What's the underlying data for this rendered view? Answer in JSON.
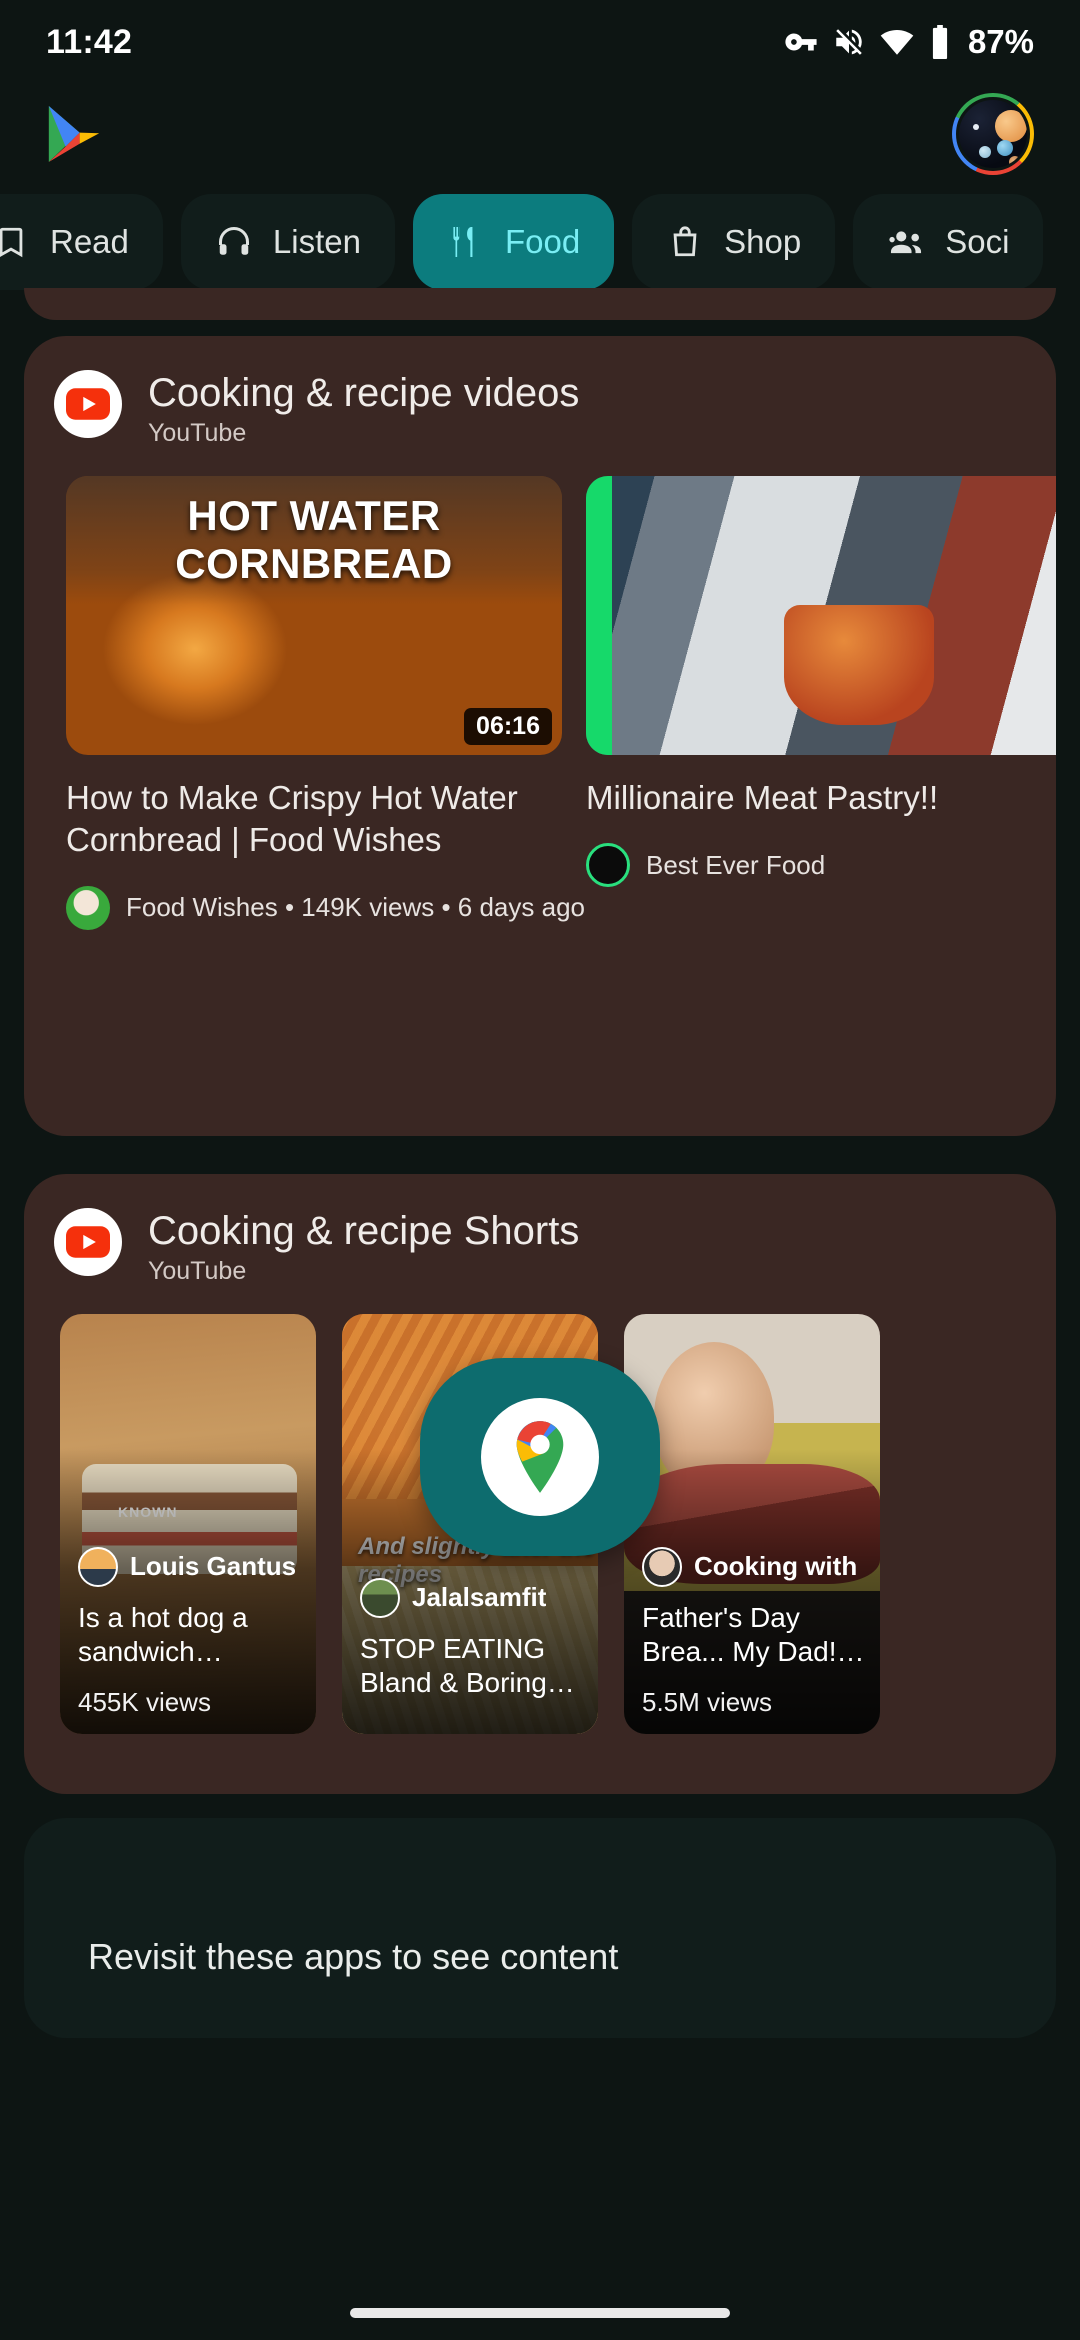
{
  "status_bar": {
    "time": "11:42",
    "battery_pct": "87%",
    "icons": [
      "vpn-key-icon",
      "volume-off-icon",
      "wifi-icon",
      "battery-icon"
    ]
  },
  "app_header": {
    "app_logo": "google-play-logo",
    "avatar": "profile-avatar"
  },
  "tabs": [
    {
      "label": "Read",
      "icon": "bookmark-icon",
      "active": false
    },
    {
      "label": "Listen",
      "icon": "headphones-icon",
      "active": false
    },
    {
      "label": "Food",
      "icon": "restaurant-icon",
      "active": true
    },
    {
      "label": "Shop",
      "icon": "shopping-bag-icon",
      "active": false
    },
    {
      "label": "Soci",
      "icon": "people-icon",
      "active": false
    }
  ],
  "colors": {
    "page_bg": "#0d1513",
    "card_bg": "#3a2723",
    "tab_bg": "#111d1b",
    "tab_active_bg": "#0c7c7e",
    "tab_active_text": "#79eef4",
    "accent_teal": "#0d6c6e"
  },
  "cards": [
    {
      "id": "cooking-recipe-videos",
      "title": "Cooking & recipe videos",
      "source": "YouTube",
      "source_icon": "youtube-icon",
      "videos": [
        {
          "thumb_headline": "HOT WATER CORNBREAD",
          "duration": "06:16",
          "title": "How to Make Crispy Hot Water Cornbread | Food Wishes",
          "channel": "Food Wishes",
          "views": "149K views",
          "age": "6 days ago",
          "meta": "Food Wishes • 149K views • 6 days ago"
        },
        {
          "thumb_headline": "",
          "duration": "",
          "title": "Millionaire Meat Pastry!!",
          "channel": "Best Ever Food",
          "views": "",
          "age": "",
          "meta": "Best Ever Food"
        }
      ]
    },
    {
      "id": "cooking-recipe-shorts",
      "title": "Cooking & recipe Shorts",
      "source": "YouTube",
      "source_icon": "youtube-icon",
      "shorts": [
        {
          "channel": "Louis Gantus",
          "title": "Is a hot dog a sandwich #cooking #food #foodas...",
          "views": "455K views"
        },
        {
          "channel": "Jalalsamfit",
          "title": "STOP EATING Bland & Boring Food!! Make High Pr...",
          "views": "",
          "caption_overlay": "And slightly alter the recipes"
        },
        {
          "channel": "Cooking with",
          "title": "Father's Day Brea... My Dad! #shorts #...",
          "views": "5.5M views"
        }
      ]
    }
  ],
  "revisit": {
    "text": "Revisit these apps to see content"
  },
  "floating_pill": {
    "app": "google-maps",
    "icon": "maps-pin-icon"
  }
}
